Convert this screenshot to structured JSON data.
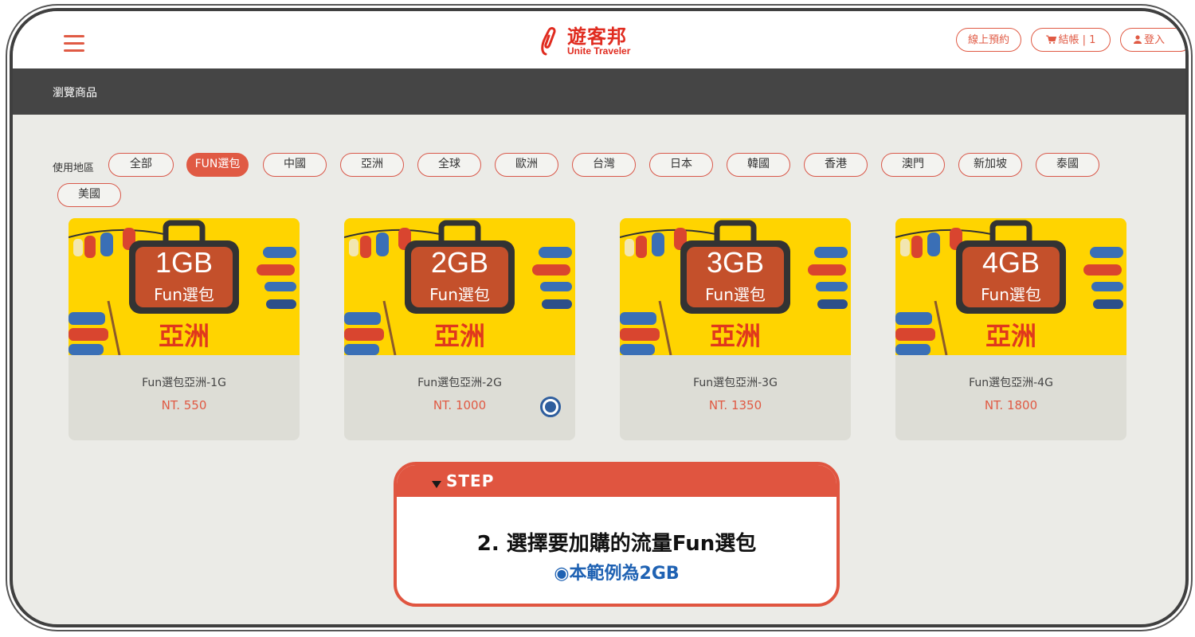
{
  "header": {
    "logo_cn": "遊客邦",
    "logo_en": "Unite Traveler",
    "nav": {
      "reserve": "線上預約",
      "checkout": "結帳 | 1",
      "login": "登入"
    }
  },
  "breadcrumb": "瀏覽商品",
  "filters": {
    "label": "使用地區",
    "chips": [
      "全部",
      "FUN選包",
      "中國",
      "亞洲",
      "全球",
      "歐洲",
      "台灣",
      "日本",
      "韓國",
      "香港",
      "澳門",
      "新加坡",
      "泰國",
      "美國"
    ],
    "active": "FUN選包"
  },
  "products": [
    {
      "size": "1GB",
      "tag": "Fun選包",
      "region": "亞洲",
      "name": "Fun選包亞洲-1G",
      "price": "NT. 550"
    },
    {
      "size": "2GB",
      "tag": "Fun選包",
      "region": "亞洲",
      "name": "Fun選包亞洲-2G",
      "price": "NT. 1000",
      "selected": true
    },
    {
      "size": "3GB",
      "tag": "Fun選包",
      "region": "亞洲",
      "name": "Fun選包亞洲-3G",
      "price": "NT. 1350"
    },
    {
      "size": "4GB",
      "tag": "Fun選包",
      "region": "亞洲",
      "name": "Fun選包亞洲-4G",
      "price": "NT. 1800"
    }
  ],
  "step": {
    "tag": "STEP",
    "title": "2. 選擇要加購的流量Fun選包",
    "subtitle": "◉本範例為2GB"
  },
  "colors": {
    "accent": "#e05a44",
    "dark_bar": "#454545",
    "page_bg": "#ebebe7",
    "card_bg": "#ddddd6",
    "banner_yellow": "#ffd400",
    "bag_brown": "#c4502b",
    "radio_blue": "#2f5e9e"
  }
}
